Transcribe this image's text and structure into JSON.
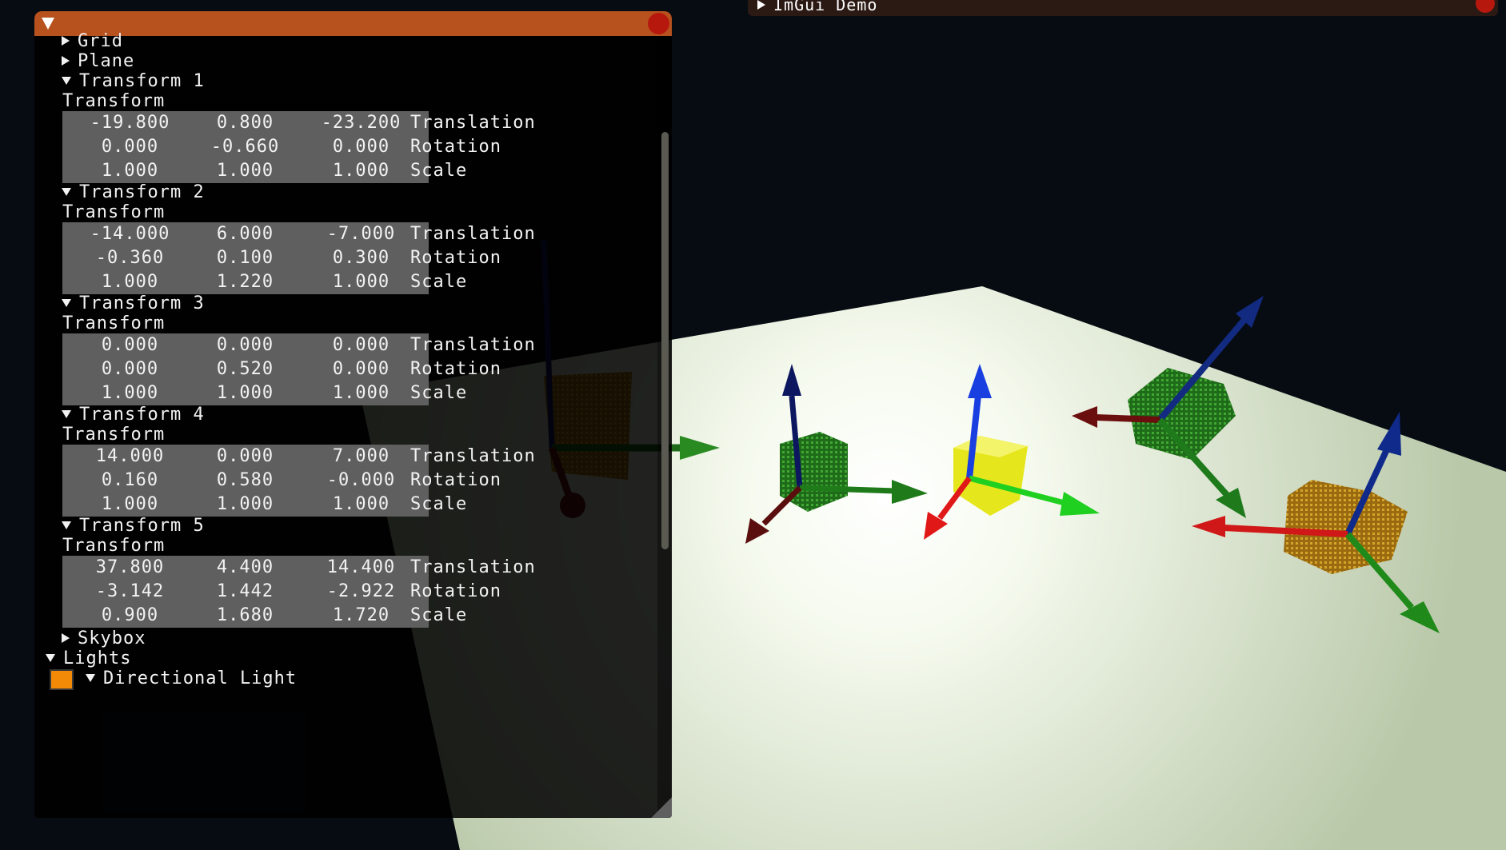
{
  "scene_window": {
    "tree": {
      "grid": "Grid",
      "plane": "Plane",
      "skybox": "Skybox",
      "lights": "Lights",
      "directional_light": "Directional Light"
    },
    "transforms": [
      {
        "title": "Transform 1",
        "header": "Transform",
        "rows": [
          {
            "values": [
              "-19.800",
              "0.800",
              "-23.200"
            ],
            "label": "Translation"
          },
          {
            "values": [
              "0.000",
              "-0.660",
              "0.000"
            ],
            "label": "Rotation"
          },
          {
            "values": [
              "1.000",
              "1.000",
              "1.000"
            ],
            "label": "Scale"
          }
        ]
      },
      {
        "title": "Transform 2",
        "header": "Transform",
        "rows": [
          {
            "values": [
              "-14.000",
              "6.000",
              "-7.000"
            ],
            "label": "Translation"
          },
          {
            "values": [
              "-0.360",
              "0.100",
              "0.300"
            ],
            "label": "Rotation"
          },
          {
            "values": [
              "1.000",
              "1.220",
              "1.000"
            ],
            "label": "Scale"
          }
        ]
      },
      {
        "title": "Transform 3",
        "header": "Transform",
        "rows": [
          {
            "values": [
              "0.000",
              "0.000",
              "0.000"
            ],
            "label": "Translation"
          },
          {
            "values": [
              "0.000",
              "0.520",
              "0.000"
            ],
            "label": "Rotation"
          },
          {
            "values": [
              "1.000",
              "1.000",
              "1.000"
            ],
            "label": "Scale"
          }
        ]
      },
      {
        "title": "Transform 4",
        "header": "Transform",
        "rows": [
          {
            "values": [
              "14.000",
              "0.000",
              "7.000"
            ],
            "label": "Translation"
          },
          {
            "values": [
              "0.160",
              "0.580",
              "-0.000"
            ],
            "label": "Rotation"
          },
          {
            "values": [
              "1.000",
              "1.000",
              "1.000"
            ],
            "label": "Scale"
          }
        ]
      },
      {
        "title": "Transform 5",
        "header": "Transform",
        "rows": [
          {
            "values": [
              "37.800",
              "4.400",
              "14.400"
            ],
            "label": "Translation"
          },
          {
            "values": [
              "-3.142",
              "1.442",
              "-2.922"
            ],
            "label": "Rotation"
          },
          {
            "values": [
              "0.900",
              "1.680",
              "1.720"
            ],
            "label": "Scale"
          }
        ]
      }
    ],
    "light_color": "#f28a08",
    "colors": {
      "titlebar": "#b7521f",
      "close": "#b6180e",
      "field": "#5f5f5f"
    }
  },
  "demo_window": {
    "title": "ImGui Demo",
    "collapsed": true
  }
}
